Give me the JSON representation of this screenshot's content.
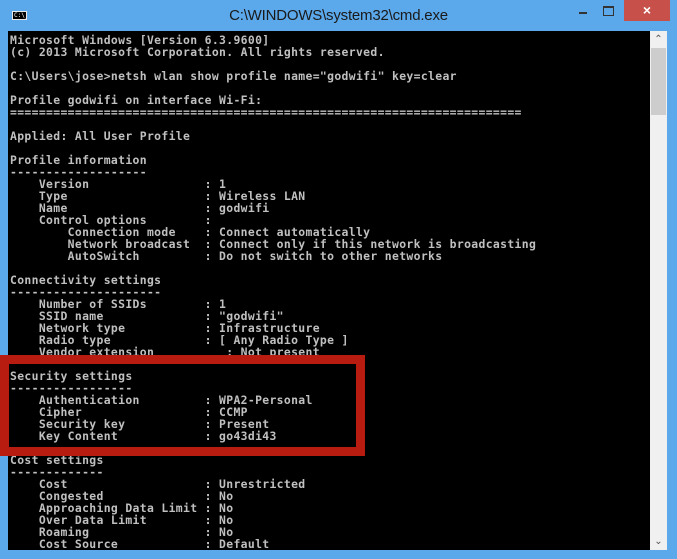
{
  "window": {
    "title": "C:\\WINDOWS\\system32\\cmd.exe",
    "icon": "cmd-icon",
    "icon_text": "C:\\_",
    "controls": {
      "minimize": "minimize",
      "maximize": "maximize",
      "close": "×"
    }
  },
  "console": {
    "lines": [
      "Microsoft Windows [Version 6.3.9600]",
      "(c) 2013 Microsoft Corporation. All rights reserved.",
      "",
      "C:\\Users\\jose>netsh wlan show profile name=\"godwifi\" key=clear",
      "",
      "Profile godwifi on interface Wi-Fi:",
      "=======================================================================",
      "",
      "Applied: All User Profile",
      "",
      "Profile information",
      "-------------------",
      "    Version                : 1",
      "    Type                   : Wireless LAN",
      "    Name                   : godwifi",
      "    Control options        :",
      "        Connection mode    : Connect automatically",
      "        Network broadcast  : Connect only if this network is broadcasting",
      "        AutoSwitch         : Do not switch to other networks",
      "",
      "Connectivity settings",
      "---------------------",
      "    Number of SSIDs        : 1",
      "    SSID name              : \"godwifi\"",
      "    Network type           : Infrastructure",
      "    Radio type             : [ Any Radio Type ]",
      "    Vendor extension          : Not present",
      "",
      "Security settings",
      "-----------------",
      "    Authentication         : WPA2-Personal",
      "    Cipher                 : CCMP",
      "    Security key           : Present",
      "    Key Content            : go43di43",
      "",
      "Cost settings",
      "-------------",
      "    Cost                   : Unrestricted",
      "    Congested              : No",
      "    Approaching Data Limit : No",
      "    Over Data Limit        : No",
      "    Roaming                : No",
      "    Cost Source            : Default"
    ]
  },
  "scrollbar": {
    "up": "^",
    "down": "v",
    "position_fraction": 0.0
  },
  "annotation": {
    "type": "highlight-box",
    "color": "#b81c10",
    "target": "Security settings"
  },
  "colors": {
    "frame": "#5ba8ea",
    "console_bg": "#000000",
    "console_fg": "#c0c0c0",
    "close_button": "#c7504b"
  }
}
